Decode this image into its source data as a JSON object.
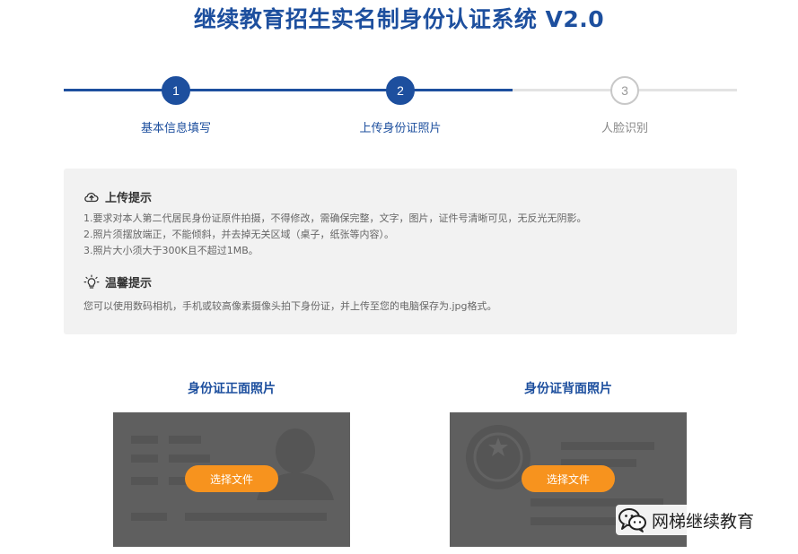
{
  "header": {
    "title": "继续教育招生实名制身份认证系统 V2.0"
  },
  "stepper": {
    "steps": [
      {
        "number": "1",
        "label": "基本信息填写",
        "state": "done"
      },
      {
        "number": "2",
        "label": "上传身份证照片",
        "state": "current"
      },
      {
        "number": "3",
        "label": "人脸识别",
        "state": "pending"
      }
    ]
  },
  "tips": {
    "upload": {
      "title": "上传提示",
      "icon": "cloud-upload-icon",
      "lines": [
        "1.要求对本人第二代居民身份证原件拍摄，不得修改，需确保完整，文字，图片，证件号清晰可见，无反光无阴影。",
        "2.照片须摆放端正，不能倾斜，并去掉无关区域（桌子，纸张等内容）。",
        "3.照片大小须大于300K且不超过1MB。"
      ]
    },
    "warm": {
      "title": "温馨提示",
      "icon": "lightbulb-icon",
      "lines": [
        "您可以使用数码相机，手机或较高像素摄像头拍下身份证，并上传至您的电脑保存为.jpg格式。"
      ]
    }
  },
  "uploads": {
    "front": {
      "title": "身份证正面照片",
      "button": "选择文件"
    },
    "back": {
      "title": "身份证背面照片",
      "button": "选择文件"
    }
  },
  "watermark": {
    "text": "网梯继续教育",
    "icon": "wechat-icon"
  },
  "colors": {
    "primary": "#1d4f9e",
    "accent": "#f7931e",
    "panel_bg": "#f2f2f2",
    "card_bg": "#5f5f5f",
    "inactive": "#c8c8c8"
  }
}
